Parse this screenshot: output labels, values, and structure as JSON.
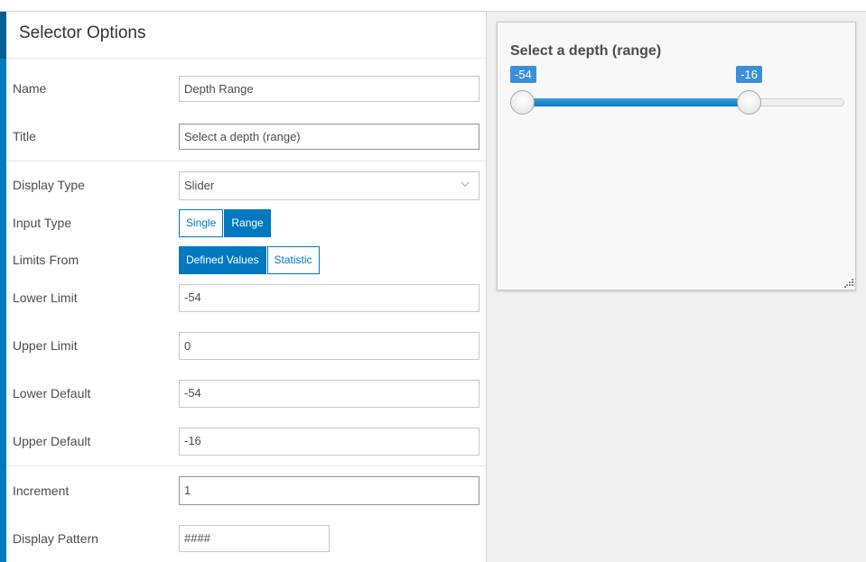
{
  "header": {
    "title": "Selector Options"
  },
  "form": {
    "name": {
      "label": "Name",
      "value": "Depth Range"
    },
    "title": {
      "label": "Title",
      "value": "Select a depth (range)"
    },
    "display_type": {
      "label": "Display Type",
      "value": "Slider"
    },
    "input_type": {
      "label": "Input Type",
      "options": [
        "Single",
        "Range"
      ],
      "selected": "Range"
    },
    "limits_from": {
      "label": "Limits From",
      "options": [
        "Defined Values",
        "Statistic"
      ],
      "selected": "Defined Values"
    },
    "lower_limit": {
      "label": "Lower Limit",
      "value": "-54"
    },
    "upper_limit": {
      "label": "Upper Limit",
      "value": "0"
    },
    "lower_default": {
      "label": "Lower Default",
      "value": "-54"
    },
    "upper_default": {
      "label": "Upper Default",
      "value": "-16"
    },
    "increment": {
      "label": "Increment",
      "value": "1"
    },
    "display_pattern": {
      "label": "Display Pattern",
      "value": "####"
    }
  },
  "preview": {
    "title": "Select a depth (range)",
    "slider": {
      "min": -54,
      "max": 0,
      "low": -54,
      "high": -16,
      "low_label": "-54",
      "high_label": "-16"
    }
  },
  "colors": {
    "accent": "#0079c1",
    "accent_dark": "#005e95",
    "badge": "#3b8fd4"
  }
}
